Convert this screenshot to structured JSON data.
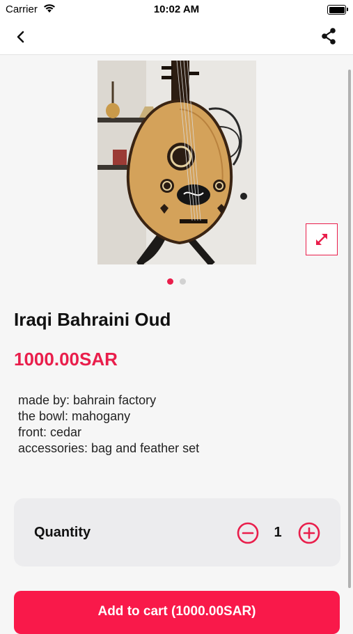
{
  "status_bar": {
    "carrier": "Carrier",
    "time": "10:02 AM"
  },
  "nav": {
    "back_icon": "chevron-left-icon",
    "share_icon": "share-icon"
  },
  "product": {
    "image_icon": "oud-photo",
    "expand_icon": "expand-icon",
    "title": "Iraqi Bahraini Oud",
    "price": "1000.00SAR",
    "description": [
      "made by: bahrain factory",
      "the bowl: mahogany",
      "front: cedar",
      "accessories: bag and feather set"
    ],
    "image_count": 2,
    "active_image": 1
  },
  "quantity": {
    "label": "Quantity",
    "value": "1"
  },
  "cart": {
    "label": "Add to cart (1000.00SAR)"
  },
  "colors": {
    "accent": "#e91e4b",
    "button": "#f9194a"
  }
}
